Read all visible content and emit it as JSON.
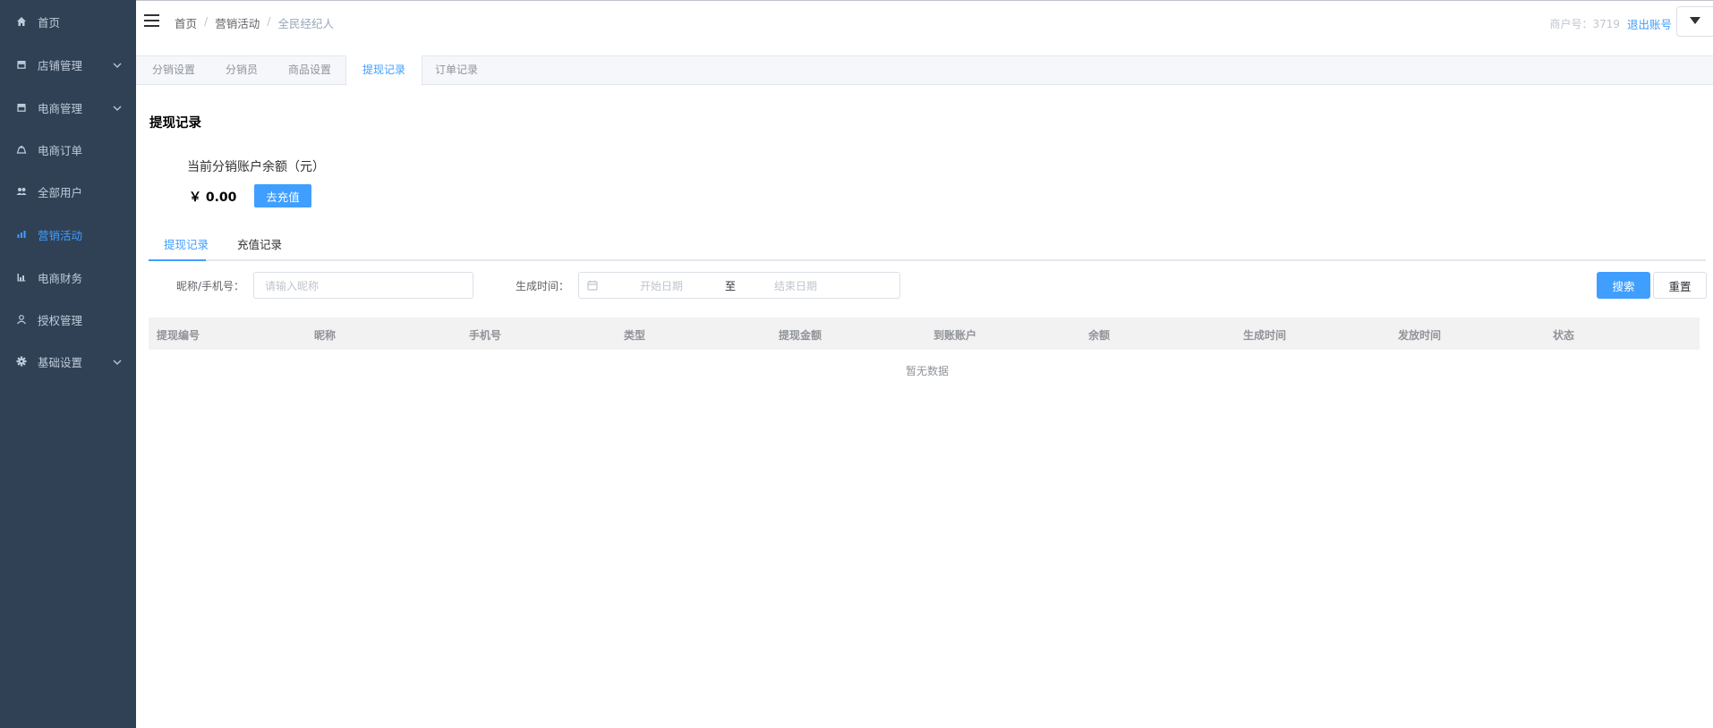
{
  "sidebar": {
    "items": [
      {
        "label": "首页",
        "icon": "home-icon",
        "has_arrow": false,
        "active": false
      },
      {
        "label": "店铺管理",
        "icon": "store-icon",
        "has_arrow": true,
        "active": false
      },
      {
        "label": "电商管理",
        "icon": "shop-icon",
        "has_arrow": true,
        "active": false
      },
      {
        "label": "电商订单",
        "icon": "order-icon",
        "has_arrow": false,
        "active": false
      },
      {
        "label": "全部用户",
        "icon": "users-icon",
        "has_arrow": false,
        "active": false
      },
      {
        "label": "营销活动",
        "icon": "chart-icon",
        "has_arrow": false,
        "active": true
      },
      {
        "label": "电商财务",
        "icon": "finance-icon",
        "has_arrow": false,
        "active": false
      },
      {
        "label": "授权管理",
        "icon": "user-icon",
        "has_arrow": false,
        "active": false
      },
      {
        "label": "基础设置",
        "icon": "gear-icon",
        "has_arrow": true,
        "active": false
      }
    ]
  },
  "header": {
    "breadcrumb": [
      "首页",
      "营销活动",
      "全民经纪人"
    ],
    "merchant": "商户号：3719",
    "logout": "退出账号"
  },
  "tabs": [
    "分销设置",
    "分销员",
    "商品设置",
    "提现记录",
    "订单记录"
  ],
  "active_tab": "提现记录",
  "main": {
    "title": "提现记录",
    "balance_label": "当前分销账户余额（元）",
    "balance_value": "￥ 0.00",
    "recharge_button": "去充值",
    "subtabs": [
      "提现记录",
      "充值记录"
    ],
    "filter": {
      "name_label": "昵称/手机号：",
      "name_placeholder": "请输入昵称",
      "time_label": "生成时间：",
      "start_placeholder": "开始日期",
      "range_sep": "至",
      "end_placeholder": "结束日期",
      "search_button": "搜索",
      "reset_button": "重置"
    },
    "table": {
      "columns": [
        "提现编号",
        "昵称",
        "手机号",
        "类型",
        "提现金额",
        "到账账户",
        "余额",
        "生成时间",
        "发放时间",
        "状态"
      ],
      "empty_text": "暂无数据"
    }
  },
  "colors": {
    "sidebar_bg": "#304156",
    "sidebar_text": "#bfcbd9",
    "accent": "#409eff"
  }
}
